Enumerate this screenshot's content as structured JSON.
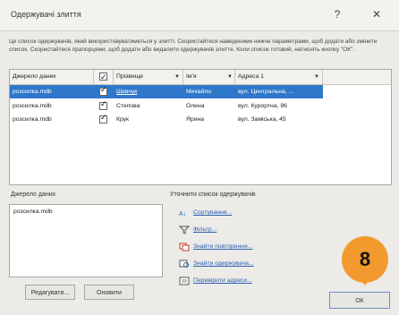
{
  "window": {
    "title": "Одержувачі злиття",
    "help_glyph": "?",
    "close_glyph": "✕"
  },
  "description": "Це список одержувачів, який використовуватиметься у злитті. Скористайтеся наведеними нижче параметрами, щоб додати або змінити список. Скористайтеся прапорцями, щоб додати або видалити одержувачів злиття. Коли список готовий, натисніть кнопку \"ОК\".",
  "grid": {
    "columns": [
      "Джерело даних",
      "",
      "Прізвище",
      "Ім'я",
      "Адреса 1"
    ],
    "rows": [
      {
        "source": "розсилка.mdb",
        "last": "Шевчук",
        "first": "Михайло",
        "address": "вул. Центральна, ...",
        "selected": true
      },
      {
        "source": "розсилка.mdb",
        "last": "Степова",
        "first": "Олена",
        "address": "вул. Курортна, 96",
        "selected": false
      },
      {
        "source": "розсилка.mdb",
        "last": "Крук",
        "first": "Ярина",
        "address": "вул. Заміська, 45",
        "selected": false
      }
    ]
  },
  "data_source": {
    "label": "Джерело даних",
    "items": [
      "розсилка.mdb"
    ],
    "edit_button": "Редагувати...",
    "refresh_button": "Оновити"
  },
  "refine": {
    "label": "Уточнити список одержувачів",
    "links": [
      "Сортування...",
      "Фільтр...",
      "Знайти повторення...",
      "Знайти одержувача...",
      "Перевірити адреси..."
    ]
  },
  "annotation": {
    "number": "8"
  },
  "ok_button": "ОК",
  "colors": {
    "selection": "#2f78c9",
    "badge": "#f29a2e",
    "link": "#2b5fb2"
  }
}
